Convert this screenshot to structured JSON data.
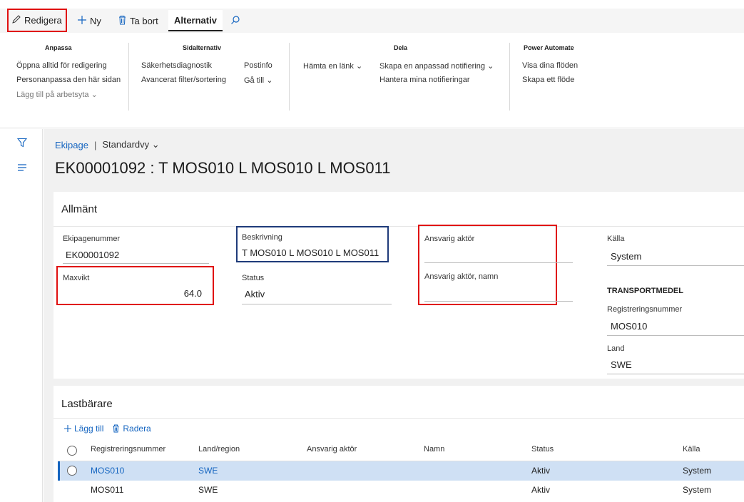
{
  "actionbar": {
    "edit_label": "Redigera",
    "new_label": "Ny",
    "delete_label": "Ta bort",
    "options_tab": "Alternativ"
  },
  "ribbon": {
    "groups": [
      {
        "title": "Anpassa",
        "items": [
          "Öppna alltid för redigering",
          "Personanpassa den här sidan",
          "Lägg till på arbetsyta"
        ]
      },
      {
        "title": "Sidalternativ",
        "items": [
          "Säkerhetsdiagnostik",
          "Avancerat filter/sortering",
          "Postinfo",
          "Gå till"
        ]
      },
      {
        "title": "Dela",
        "items": [
          "Hämta en länk",
          "Skapa en anpassad notifiering",
          "Hantera mina notifieringar"
        ]
      },
      {
        "title": "Power Automate",
        "items": [
          "Visa dina flöden",
          "Skapa ett flöde"
        ]
      }
    ]
  },
  "breadcrumb": {
    "link": "Ekipage",
    "separator": "|",
    "view": "Standardvy"
  },
  "page_title": "EK00001092 : T MOS010 L MOS010 L MOS011",
  "general": {
    "title": "Allmänt",
    "ekipagenummer_label": "Ekipagenummer",
    "ekipagenummer_value": "EK00001092",
    "maxvikt_label": "Maxvikt",
    "maxvikt_value": "64.0",
    "beskrivning_label": "Beskrivning",
    "beskrivning_value": "T MOS010 L MOS010 L MOS011",
    "status_label": "Status",
    "status_value": "Aktiv",
    "ansvarig_label": "Ansvarig aktör",
    "ansvarig_namn_label": "Ansvarig aktör, namn",
    "kalla_label": "Källa",
    "kalla_value": "System",
    "transport_title": "TRANSPORTMEDEL",
    "regnr_label": "Registreringsnummer",
    "regnr_value": "MOS010",
    "land_label": "Land",
    "land_value": "SWE"
  },
  "carriers": {
    "title": "Lastbärare",
    "add_label": "Lägg till",
    "remove_label": "Radera",
    "columns": [
      "Registreringsnummer",
      "Land/region",
      "Ansvarig aktör",
      "Namn",
      "Status",
      "Källa"
    ],
    "rows": [
      [
        "MOS010",
        "SWE",
        "",
        "",
        "Aktiv",
        "System"
      ],
      [
        "MOS011",
        "SWE",
        "",
        "",
        "Aktiv",
        "System"
      ]
    ]
  },
  "colors": {
    "accent": "#1565c0",
    "highlight_red": "#e01010",
    "highlight_blue": "#1f3b7a",
    "selected_row": "#cfe0f4"
  }
}
